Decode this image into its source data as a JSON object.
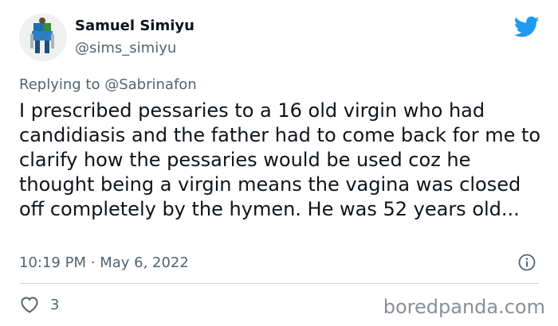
{
  "author": {
    "name": "Samuel Simiyu",
    "handle": "@sims_simiyu"
  },
  "reply": {
    "prefix": "Replying to",
    "mention": "@Sabrinafon"
  },
  "tweet_text": "I prescribed pessaries to a 16 old virgin who had candidiasis and the father had to come back for me to clarify how the pessaries would be used coz he thought being a virgin means the vagina was closed off completely by the hymen. He was 52 years old...",
  "meta": {
    "time": "10:19 PM",
    "separator": "·",
    "date": "May 6, 2022"
  },
  "likes": "3",
  "watermark": "boredpanda.com",
  "colors": {
    "twitter_blue": "#1d9bf0",
    "secondary_text": "#536471",
    "primary_text": "#0f1419",
    "divider": "#cfd9de"
  },
  "icons": [
    "twitter-bird-icon",
    "info-icon",
    "heart-icon"
  ]
}
